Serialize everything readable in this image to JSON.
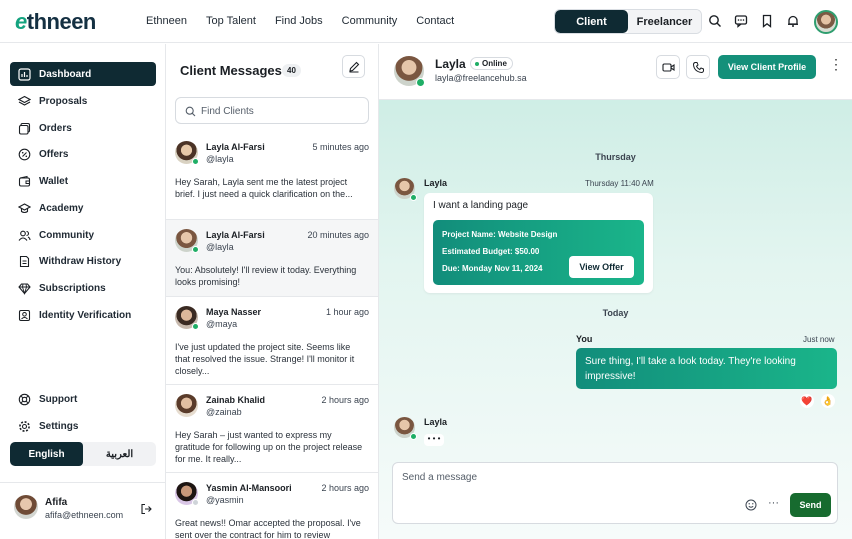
{
  "brand": {
    "logo_e": "e",
    "logo_rest": "thneen"
  },
  "nav": [
    "Ethneen",
    "Top Talent",
    "Find Jobs",
    "Community",
    "Contact"
  ],
  "mode_switch": {
    "active": "Client",
    "inactive": "Freelancer"
  },
  "sidebar": {
    "items": [
      {
        "label": "Dashboard",
        "icon": "dashboard-icon",
        "active": true
      },
      {
        "label": "Proposals",
        "icon": "layers-icon"
      },
      {
        "label": "Orders",
        "icon": "orders-icon"
      },
      {
        "label": "Offers",
        "icon": "percent-icon"
      },
      {
        "label": "Wallet",
        "icon": "wallet-icon"
      },
      {
        "label": "Academy",
        "icon": "graduation-cap-icon"
      },
      {
        "label": "Community",
        "icon": "users-icon"
      },
      {
        "label": "Withdraw History",
        "icon": "document-icon"
      },
      {
        "label": "Subscriptions",
        "icon": "diamond-icon"
      },
      {
        "label": "Identity Verification",
        "icon": "id-badge-icon"
      }
    ],
    "support": "Support",
    "settings": "Settings",
    "lang": {
      "english": "English",
      "arabic": "العربية"
    },
    "user": {
      "name": "Afifa",
      "email": "afifa@ethneen.com"
    }
  },
  "messages": {
    "title": "Client Messages",
    "count": "40",
    "search_placeholder": "Find Clients",
    "conversations": [
      {
        "name": "Layla Al-Farsi",
        "handle": "@layla",
        "time": "5 minutes ago",
        "text": "Hey Sarah, Layla sent me the latest project brief. I just need a quick clarification on the..."
      },
      {
        "name": "Layla Al-Farsi",
        "handle": "@layla",
        "time": "20 minutes ago",
        "text": "You: Absolutely! I'll review it today. Everything looks promising!"
      },
      {
        "name": "Maya Nasser",
        "handle": "@maya",
        "time": "1 hour ago",
        "text": "I've just updated the project site. Seems like that resolved the issue. Strange! I'll monitor it closely..."
      },
      {
        "name": "Zainab Khalid",
        "handle": "@zainab",
        "time": "2 hours ago",
        "text": "Hey Sarah – just wanted to express my gratitude for following up on the project release for me. It really..."
      },
      {
        "name": "Yasmin Al-Mansoori",
        "handle": "@yasmin",
        "time": "2 hours ago",
        "text": "Great news!! Omar accepted the proposal. I've sent over the contract for him to review"
      }
    ]
  },
  "chat": {
    "name": "Layla",
    "status": "Online",
    "email": "layla@freelancehub.sa",
    "view_profile": "View Client Profile",
    "day1": "Thursday",
    "day2": "Today",
    "msg1": {
      "sender": "Layla",
      "time": "Thursday 11:40 AM",
      "text": "I want a landing page",
      "offer": {
        "project": "Project Name: Website Design",
        "budget": "Estimated Budget: $50.00",
        "due": "Due: Monday Nov 11, 2024",
        "button": "View Offer"
      }
    },
    "msg2": {
      "sender": "You",
      "time": "Just now",
      "text": "Sure thing, I'll take a look today. They're looking impressive!",
      "reactions": [
        "❤️",
        "👌"
      ]
    },
    "msg3": {
      "sender": "Layla",
      "typing": "• • •"
    },
    "composer_placeholder": "Send a message",
    "send": "Send"
  }
}
